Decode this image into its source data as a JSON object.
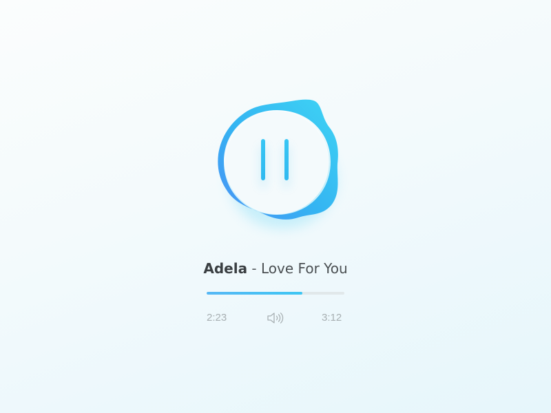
{
  "player": {
    "state": "playing",
    "controls": {
      "toggle_icon": "pause-icon",
      "volume_icon": "volume-icon"
    },
    "track": {
      "artist": "Adela",
      "separator": " - ",
      "title": "Love For You"
    },
    "progress": {
      "elapsed": "2:23",
      "total": "3:12",
      "fraction": 0.695
    }
  },
  "colors": {
    "accent": "#3ec6f3",
    "accent_blue": "#4a9bf4",
    "time_text": "#a7afb2",
    "track_bg": "#e1e8ea"
  }
}
